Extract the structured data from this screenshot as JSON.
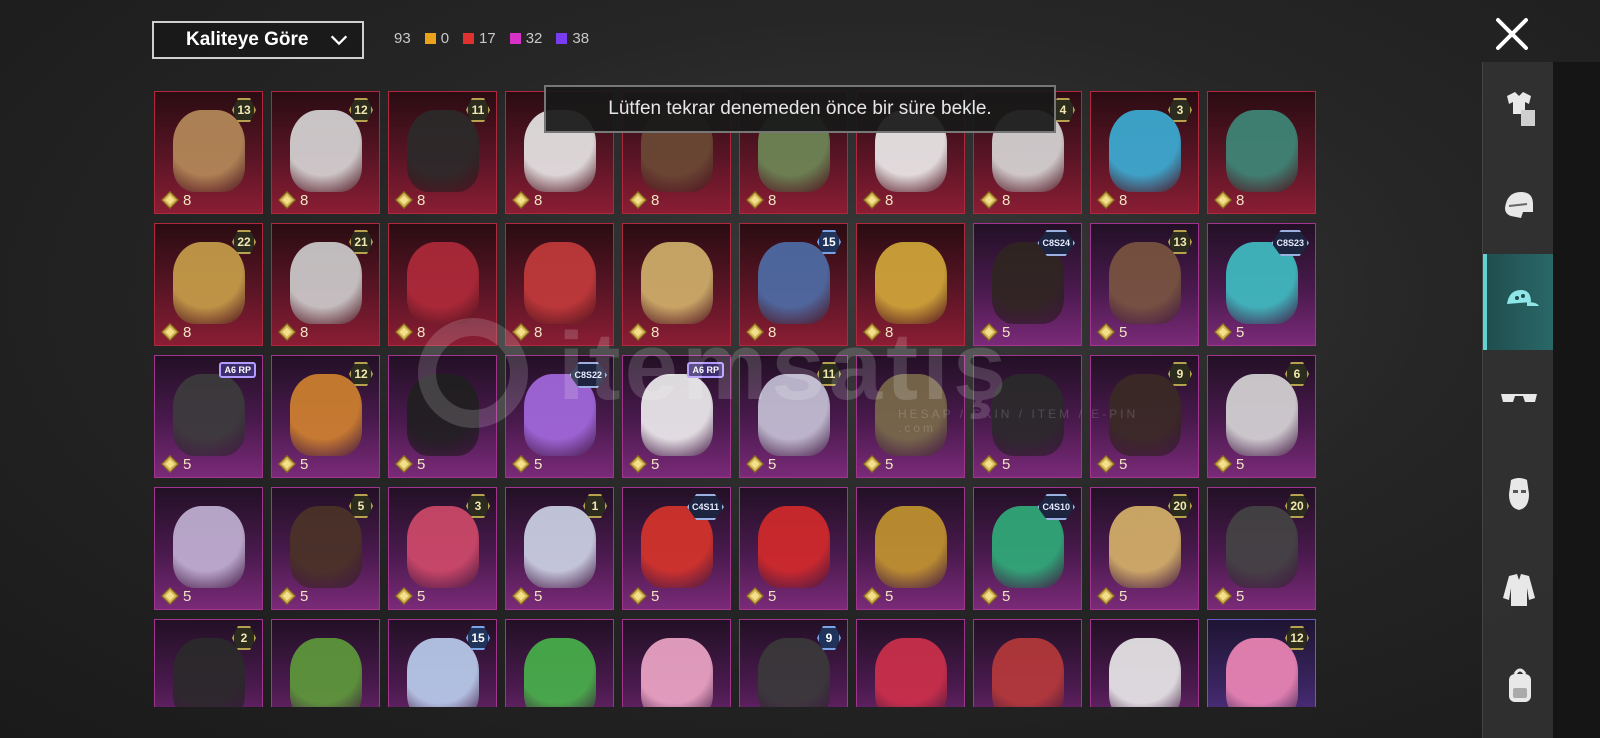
{
  "filter": {
    "label": "Kaliteye Göre"
  },
  "counts": {
    "total": "93",
    "items": [
      {
        "color": "#e9a21a",
        "value": "0"
      },
      {
        "color": "#e03131",
        "value": "17"
      },
      {
        "color": "#d632c7",
        "value": "32"
      },
      {
        "color": "#7a3cf0",
        "value": "38"
      }
    ]
  },
  "notice": {
    "text": "Lütfen tekrar denemeden önce bir süre bekle."
  },
  "watermark": {
    "main": "itemsatış",
    "sub": "HESAP / SKIN / ITEM / E-PIN",
    "suffix": ".com"
  },
  "grid": {
    "rows": [
      [
        {
          "badge": "13",
          "cost": "8",
          "tier": "red",
          "art": "#b78c5a"
        },
        {
          "badge": "12",
          "cost": "8",
          "tier": "red",
          "art": "#d8d8d8"
        },
        {
          "badge": "11",
          "cost": "8",
          "tier": "red",
          "art": "#2a2a2a"
        },
        {
          "badge": "",
          "cost": "8",
          "tier": "red",
          "art": "#e9e9e9"
        },
        {
          "badge": "",
          "cost": "8",
          "tier": "red",
          "art": "#6b4a35"
        },
        {
          "badge": "",
          "cost": "8",
          "tier": "red",
          "art": "#6d8a57"
        },
        {
          "badge": "",
          "cost": "8",
          "tier": "red",
          "art": "#efefef"
        },
        {
          "badge": "4",
          "cost": "8",
          "tier": "red",
          "art": "#d9d9d9"
        },
        {
          "badge": "3",
          "cost": "8",
          "tier": "red",
          "art": "#3bb0d8"
        },
        {
          "badge": "",
          "cost": "8",
          "tier": "red",
          "art": "#3d8a7a"
        }
      ],
      [
        {
          "badge": "22",
          "cost": "8",
          "tier": "red",
          "art": "#c9a14a"
        },
        {
          "badge": "21",
          "cost": "8",
          "tier": "red",
          "art": "#cfcfcf"
        },
        {
          "badge": "",
          "cost": "8",
          "tier": "red",
          "art": "#b02a3a"
        },
        {
          "badge": "",
          "cost": "8",
          "tier": "red",
          "art": "#c43b3b"
        },
        {
          "badge": "",
          "cost": "8",
          "tier": "red",
          "art": "#d2b36c"
        },
        {
          "badge": "15",
          "badgeStyle": "blue",
          "cost": "8",
          "tier": "red",
          "art": "#4d6ea8"
        },
        {
          "badge": "",
          "cost": "8",
          "tier": "red",
          "art": "#d4aa3a"
        },
        {
          "badge": "C8S24",
          "badgeStyle": "cbs",
          "cost": "5",
          "tier": "pur",
          "art": "#2f2520"
        },
        {
          "badge": "13",
          "cost": "5",
          "tier": "pur",
          "art": "#7a5540"
        },
        {
          "badge": "C8S23",
          "badgeStyle": "cbs",
          "cost": "5",
          "tier": "pur",
          "art": "#3fc0c4"
        }
      ],
      [
        {
          "badge": "A6 RP",
          "badgeStyle": "tag",
          "cost": "5",
          "tier": "pur",
          "art": "#3c3c3c"
        },
        {
          "badge": "12",
          "cost": "5",
          "tier": "pur",
          "art": "#d2832e"
        },
        {
          "badge": "",
          "cost": "5",
          "tier": "pur",
          "art": "#1f1f1f"
        },
        {
          "badge": "C8S22",
          "badgeStyle": "cbs",
          "cost": "5",
          "tier": "pur",
          "art": "#a46ae0"
        },
        {
          "badge": "A6 RP",
          "badgeStyle": "tag",
          "cost": "5",
          "tier": "pur",
          "art": "#f0f0f0"
        },
        {
          "badge": "11",
          "cost": "5",
          "tier": "pur",
          "art": "#c7c4d8"
        },
        {
          "badge": "",
          "cost": "5",
          "tier": "pur",
          "art": "#7a6b4a"
        },
        {
          "badge": "",
          "cost": "5",
          "tier": "pur",
          "art": "#2a2a2a"
        },
        {
          "badge": "9",
          "cost": "5",
          "tier": "pur",
          "art": "#3a2a24"
        },
        {
          "badge": "6",
          "cost": "5",
          "tier": "pur",
          "art": "#d8d8d8"
        }
      ],
      [
        {
          "badge": "",
          "cost": "5",
          "tier": "pur",
          "art": "#c4b4d6"
        },
        {
          "badge": "5",
          "cost": "5",
          "tier": "pur",
          "art": "#4b3326"
        },
        {
          "badge": "3",
          "cost": "5",
          "tier": "pur",
          "art": "#d24a6a"
        },
        {
          "badge": "1",
          "cost": "5",
          "tier": "pur",
          "art": "#cfd6e8"
        },
        {
          "badge": "C4S11",
          "badgeStyle": "cbs",
          "cost": "5",
          "tier": "pur",
          "art": "#d8342a"
        },
        {
          "badge": "",
          "cost": "5",
          "tier": "pur",
          "art": "#d52a2a"
        },
        {
          "badge": "",
          "cost": "5",
          "tier": "pur",
          "art": "#c4962e"
        },
        {
          "badge": "C4S10",
          "badgeStyle": "cbs",
          "cost": "5",
          "tier": "pur",
          "art": "#2fae7a"
        },
        {
          "badge": "20",
          "cost": "5",
          "tier": "pur",
          "art": "#d8b46a"
        },
        {
          "badge": "20",
          "cost": "5",
          "tier": "pur",
          "art": "#444"
        }
      ],
      [
        {
          "badge": "2",
          "cost": "",
          "tier": "pur",
          "art": "#2a2a2a"
        },
        {
          "badge": "",
          "cost": "",
          "tier": "pur",
          "art": "#5e9c3a"
        },
        {
          "badge": "15",
          "badgeStyle": "blue",
          "cost": "",
          "tier": "pur",
          "art": "#bcd0f0"
        },
        {
          "badge": "",
          "cost": "",
          "tier": "pur",
          "art": "#48b44a"
        },
        {
          "badge": "",
          "cost": "",
          "tier": "pur",
          "art": "#f0a8c8"
        },
        {
          "badge": "9",
          "badgeStyle": "blue",
          "cost": "",
          "tier": "pur",
          "art": "#3a3a3a"
        },
        {
          "badge": "",
          "cost": "",
          "tier": "pur",
          "art": "#d0304a"
        },
        {
          "badge": "",
          "cost": "",
          "tier": "pur",
          "art": "#b83a3a"
        },
        {
          "badge": "",
          "cost": "",
          "tier": "pur",
          "art": "#ececec"
        },
        {
          "badge": "12",
          "cost": "",
          "tier": "blu",
          "art": "#f088b8"
        }
      ]
    ]
  },
  "sidebar": {
    "items": [
      {
        "icon": "outfit-icon",
        "active": false
      },
      {
        "icon": "helmet-icon",
        "active": false
      },
      {
        "icon": "cap-icon",
        "active": true
      },
      {
        "icon": "glasses-icon",
        "active": false
      },
      {
        "icon": "mask-icon",
        "active": false
      },
      {
        "icon": "jacket-icon",
        "active": false
      },
      {
        "icon": "backpack-icon",
        "active": false
      }
    ]
  }
}
